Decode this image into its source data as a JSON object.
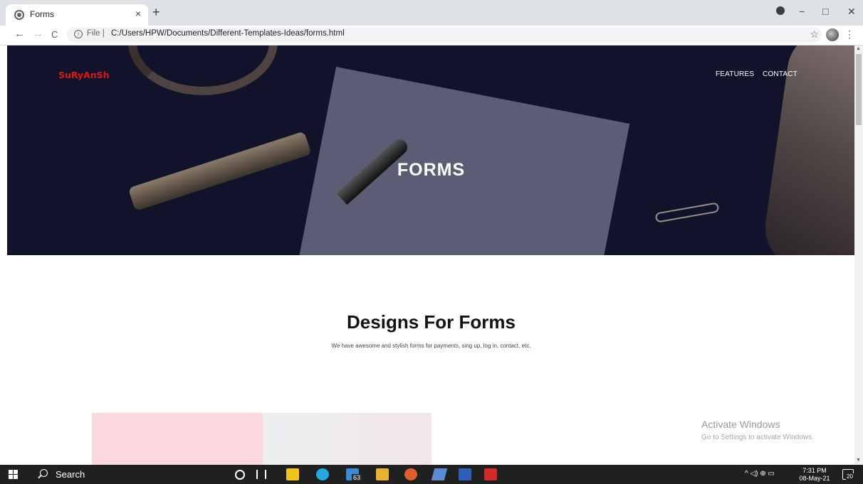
{
  "browser": {
    "tab_title": "Forms",
    "close_glyph": "×",
    "new_tab_glyph": "+",
    "back_glyph": "←",
    "forward_glyph": "→",
    "reload_glyph": "C",
    "url_prefix": "File |",
    "url": "C:/Users/HPW/Documents/Different-Templates-Ideas/forms.html",
    "info_glyph": "i",
    "star_glyph": "☆",
    "menu_glyph": "⋮",
    "minimize_glyph": "−",
    "maximize_glyph": "□",
    "window_close_glyph": "✕"
  },
  "page": {
    "brand": "SuRyAnSh",
    "nav": [
      "FEATURES",
      "CONTACT"
    ],
    "hero_title": "FORMS",
    "section_title": "Designs For Forms",
    "section_subtitle": "We have awesome and stylish forms for payments, sing up, log in, contact, etc."
  },
  "watermark": {
    "title": "Activate Windows",
    "subtitle": "Go to Settings to activate Windows."
  },
  "taskbar": {
    "search_label": "Search",
    "mail_badge": "63",
    "time": "7:31 PM",
    "date": "08-May-21",
    "notification_count": "20",
    "tray_glyphs": "^ ◁) ⊕ ▭"
  },
  "colors": {
    "brand": "#e01515",
    "hero_bg": "#11132a",
    "taskbar": "#202020"
  }
}
